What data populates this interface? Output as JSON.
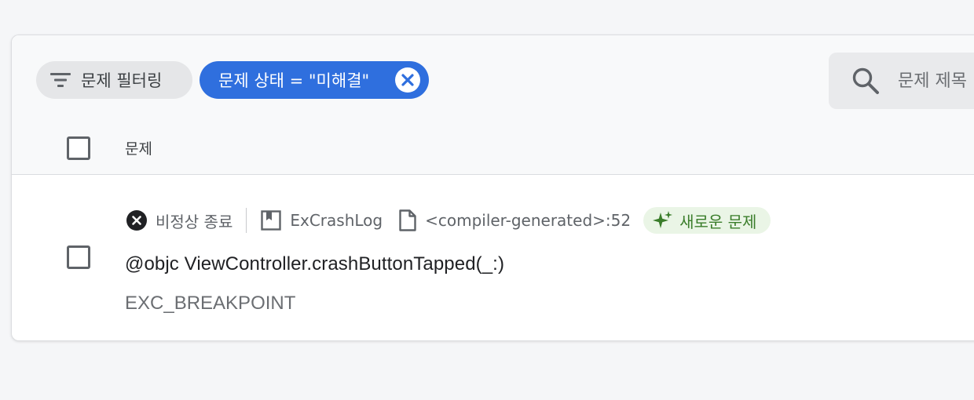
{
  "toolbar": {
    "filter_button_label": "문제 필터링",
    "active_filter_label": "문제 상태 = \"미해결\"",
    "search": {
      "placeholder": "문제 제목",
      "value": ""
    }
  },
  "table": {
    "column_header": "문제"
  },
  "issues": [
    {
      "status": "비정상 종료",
      "module": "ExCrashLog",
      "file": "<compiler-generated>:52",
      "badge": "새로운 문제",
      "title": "@objc ViewController.crashButtonTapped(_:)",
      "subtitle": "EXC_BREAKPOINT"
    }
  ],
  "colors": {
    "accent": "#2f6fde",
    "badge_bg": "#eaf5e6",
    "badge_text": "#3a7d2a",
    "background": "#f5f6f8"
  },
  "icons": {
    "filter": "filter-icon",
    "remove_filter": "close-circle-icon",
    "search": "search-icon",
    "crash": "crash-x-icon",
    "module": "bookmark-icon",
    "file": "file-icon",
    "new": "sparkle-icon"
  }
}
